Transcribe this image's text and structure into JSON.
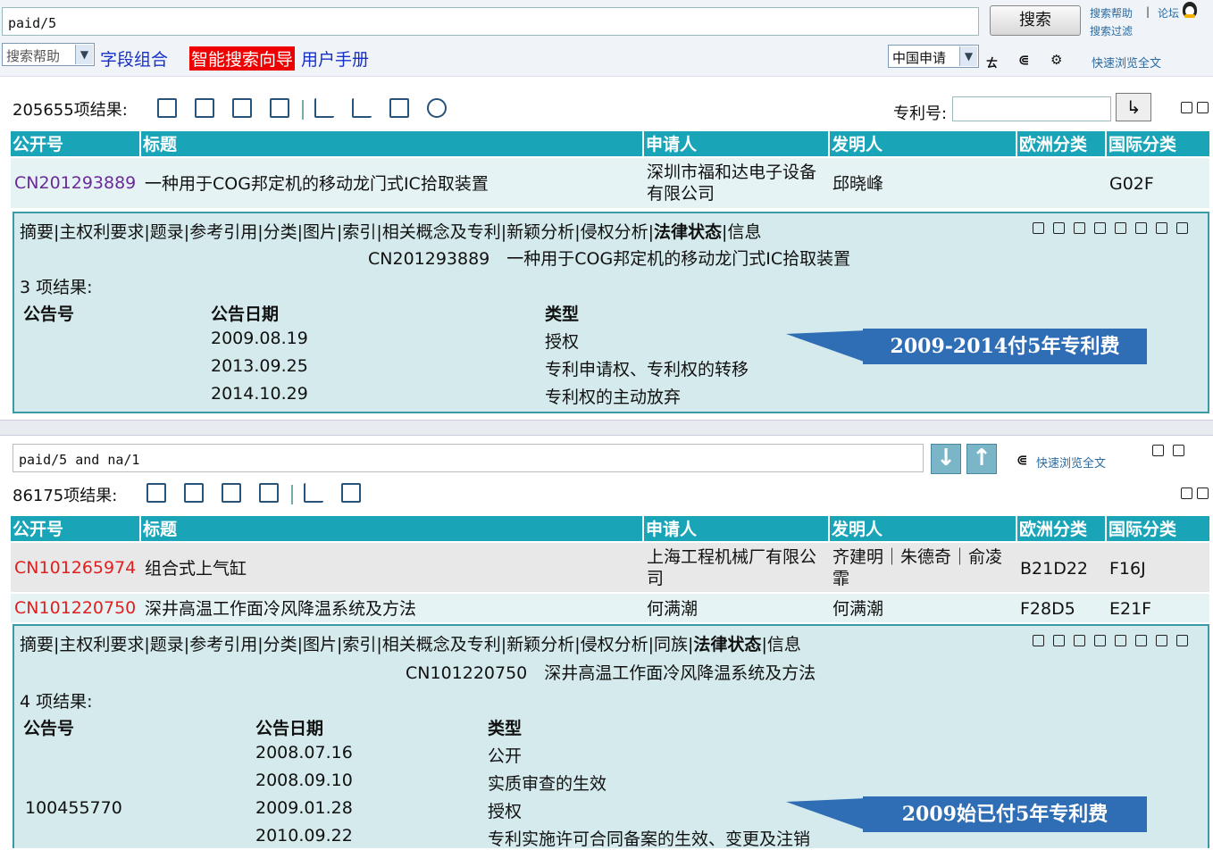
{
  "top": {
    "query": "paid/5",
    "search_button": "搜索",
    "help_links": [
      "搜索帮助",
      "论坛",
      "搜索过滤"
    ],
    "search_help_select": "搜索帮助",
    "field_combo": "字段组合",
    "smart_guide": "智能搜索向导",
    "user_manual": "用户手册",
    "country_select": "中国申请",
    "quick_browse": "快速浏览全文"
  },
  "panel1": {
    "result_count": "205655项结果:",
    "patent_no_label": "专利号:",
    "headers": [
      "公开号",
      "标题",
      "申请人",
      "发明人",
      "欧洲分类",
      "国际分类"
    ],
    "rows": [
      {
        "pub": "CN201293889",
        "title": "一种用于COG邦定机的移动龙门式IC拾取装置",
        "applicant": "深圳市福和达电子设备有限公司",
        "inventor": "邱晓峰",
        "ecla": "",
        "ipc": "G02F"
      }
    ],
    "detail": {
      "tabs_before": "摘要|主权利要求|题录|参考引用|分类|图片|索引|相关概念及专利|新颖分析|侵权分析|",
      "tab_bold": "法律状态",
      "tabs_after": "|信息",
      "heading": "CN201293889　一种用于COG邦定机的移动龙门式IC拾取装置",
      "count": "3 项结果:",
      "col_headers": [
        "公告号",
        "公告日期",
        "类型"
      ],
      "entries": [
        {
          "no": "",
          "date": "2009.08.19",
          "type": "授权"
        },
        {
          "no": "",
          "date": "2013.09.25",
          "type": "专利申请权、专利权的转移"
        },
        {
          "no": "",
          "date": "2014.10.29",
          "type": "专利权的主动放弃"
        }
      ]
    },
    "callout": "2009-2014付5年专利费"
  },
  "panel2": {
    "query": "paid/5 and na/1",
    "quick_browse": "快速浏览全文",
    "result_count": "86175项结果:",
    "headers": [
      "公开号",
      "标题",
      "申请人",
      "发明人",
      "欧洲分类",
      "国际分类"
    ],
    "rows": [
      {
        "pub": "CN101265974",
        "title": "组合式上气缸",
        "applicant": "上海工程机械厂有限公司",
        "inventor": "齐建明｜朱德奇｜俞凌霏",
        "ecla": "B21D22",
        "ipc": "F16J"
      },
      {
        "pub": "CN101220750",
        "title": "深井高温工作面冷风降温系统及方法",
        "applicant": "何满潮",
        "inventor": "何满潮",
        "ecla": "F28D5",
        "ipc": "E21F"
      }
    ],
    "detail": {
      "tabs_before": "摘要|主权利要求|题录|参考引用|分类|图片|索引|相关概念及专利|新颖分析|侵权分析|同族|",
      "tab_bold": "法律状态",
      "tabs_after": "|信息",
      "heading": "CN101220750　深井高温工作面冷风降温系统及方法",
      "count": "4 项结果:",
      "col_headers": [
        "公告号",
        "公告日期",
        "类型"
      ],
      "entries": [
        {
          "no": "",
          "date": "2008.07.16",
          "type": "公开"
        },
        {
          "no": "",
          "date": "2008.09.10",
          "type": "实质审查的生效"
        },
        {
          "no": "100455770",
          "date": "2009.01.28",
          "type": "授权"
        },
        {
          "no": "",
          "date": "2010.09.22",
          "type": "专利实施许可合同备案的生效、变更及注销"
        }
      ]
    },
    "callout": "2009始已付5年专利费"
  },
  "colors": {
    "header_teal": "#1aa4b8",
    "detail_bg": "#d4eaec",
    "callout_blue": "#2f6db5",
    "link_blue": "#1530c8",
    "pub_red": "#e02020",
    "pub_purple": "#6a2a9a"
  }
}
